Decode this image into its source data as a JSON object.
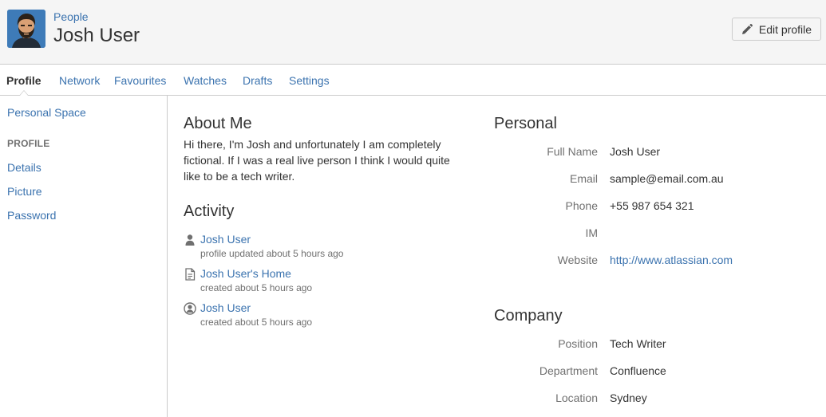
{
  "header": {
    "breadcrumb": "People",
    "title": "Josh User",
    "edit_label": "Edit profile"
  },
  "tabs": [
    {
      "label": "Profile",
      "active": true
    },
    {
      "label": "Network"
    },
    {
      "label": "Favourites"
    },
    {
      "label": "Watches"
    },
    {
      "label": "Drafts"
    },
    {
      "label": "Settings"
    }
  ],
  "sidebar": {
    "personal_space": "Personal Space",
    "heading": "PROFILE",
    "items": [
      {
        "label": "Details"
      },
      {
        "label": "Picture"
      },
      {
        "label": "Password"
      }
    ]
  },
  "about": {
    "title": "About Me",
    "text": "Hi there, I'm Josh and unfortunately I am completely fictional. If I was a real live person I think I would quite like to be a tech writer."
  },
  "activity": {
    "title": "Activity",
    "items": [
      {
        "icon": "user-icon",
        "link": "Josh User",
        "meta": "profile updated about 5 hours ago"
      },
      {
        "icon": "page-icon",
        "link": "Josh User's Home",
        "meta": "created about 5 hours ago"
      },
      {
        "icon": "user-circle-icon",
        "link": "Josh User",
        "meta": "created about 5 hours ago"
      }
    ]
  },
  "personal": {
    "title": "Personal",
    "fields": [
      {
        "label": "Full Name",
        "value": "Josh User"
      },
      {
        "label": "Email",
        "value": "sample@email.com.au"
      },
      {
        "label": "Phone",
        "value": "+55 987 654 321"
      },
      {
        "label": "IM",
        "value": ""
      },
      {
        "label": "Website",
        "value": "http://www.atlassian.com"
      }
    ]
  },
  "company": {
    "title": "Company",
    "fields": [
      {
        "label": "Position",
        "value": "Tech Writer"
      },
      {
        "label": "Department",
        "value": "Confluence"
      },
      {
        "label": "Location",
        "value": "Sydney"
      }
    ]
  },
  "colors": {
    "link": "#3b73af",
    "text": "#333333",
    "muted": "#707070",
    "border": "#cccccc",
    "header_bg": "#f5f5f5"
  }
}
